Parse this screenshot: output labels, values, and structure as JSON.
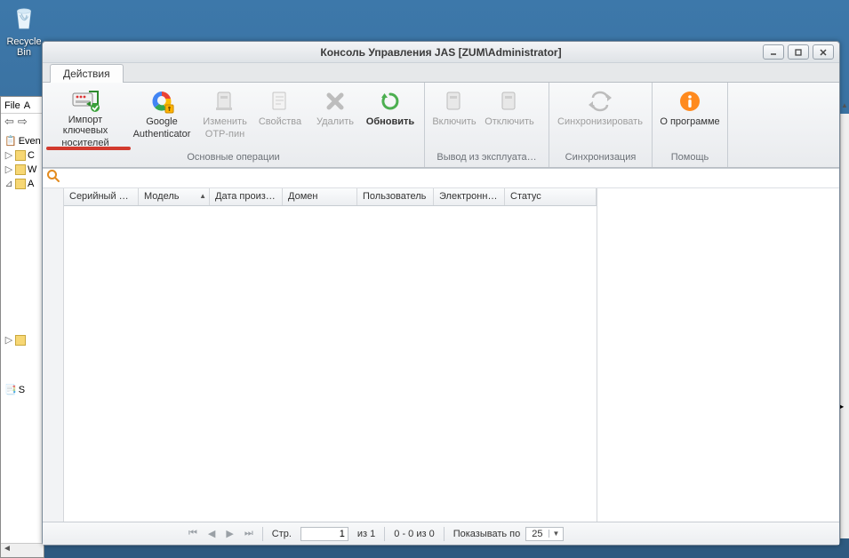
{
  "desktop": {
    "recycle_bin_label": "Recycle Bin"
  },
  "under": {
    "menu": {
      "file": "File",
      "a": "A"
    },
    "tree": {
      "root": "Even",
      "c": "C",
      "w": "W",
      "a": "A",
      "s": "S"
    }
  },
  "window": {
    "title": "Консоль Управления JAS  [ZUM\\Administrator]",
    "tab": "Действия",
    "ribbon_groups": {
      "main": {
        "label": "Основные операции",
        "items": {
          "import": {
            "l1": "Импорт ключевых",
            "l2": "носителей"
          },
          "gauth": {
            "l1": "Google",
            "l2": "Authenticator"
          },
          "otp": {
            "l1": "Изменить",
            "l2": "OTP-пин"
          },
          "props": {
            "l1": "Свойства",
            "l2": ""
          },
          "delete": {
            "l1": "Удалить",
            "l2": ""
          },
          "refresh": {
            "l1": "Обновить",
            "l2": ""
          }
        }
      },
      "exploit": {
        "label": "Вывод из эксплуата…",
        "items": {
          "enable": {
            "l1": "Включить",
            "l2": ""
          },
          "disable": {
            "l1": "Отключить",
            "l2": ""
          }
        }
      },
      "sync": {
        "label": "Синхронизация",
        "items": {
          "sync": {
            "l1": "Синхронизировать",
            "l2": ""
          }
        }
      },
      "help": {
        "label": "Помощь",
        "items": {
          "about": {
            "l1": "О программе",
            "l2": ""
          }
        }
      }
    },
    "columns": {
      "serial": "Серийный но…",
      "model": "Модель",
      "mfg": "Дата произв…",
      "domain": "Домен",
      "user": "Пользователь",
      "email": "Электронна…",
      "status": "Статус"
    },
    "pager": {
      "page_label": "Стр.",
      "page_value": "1",
      "of_text": "из 1",
      "range": "0 - 0  из 0",
      "per_label": "Показывать по",
      "per_value": "25"
    }
  }
}
